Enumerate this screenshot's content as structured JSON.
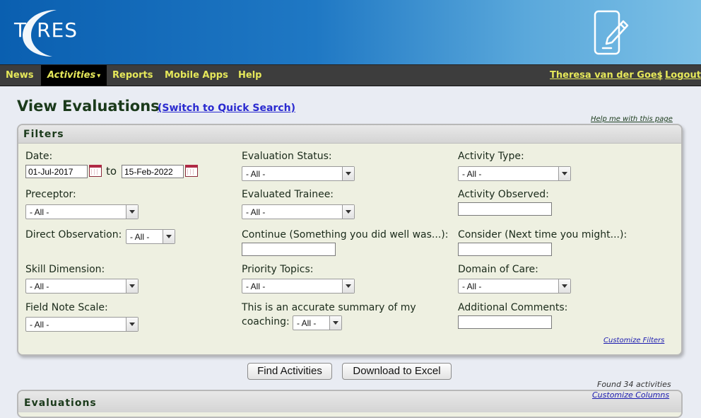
{
  "header": {
    "logo_text": "T RES",
    "logo_letters": [
      "T",
      "RES"
    ]
  },
  "nav": {
    "items": [
      {
        "label": "News"
      },
      {
        "label": "Activities",
        "active": true
      },
      {
        "label": "Reports"
      },
      {
        "label": "Mobile Apps"
      },
      {
        "label": "Help"
      }
    ],
    "caret": "▾",
    "user": "Theresa van der Goes",
    "separator": "|",
    "logout": "Logout",
    "text_color": "#e6e85a"
  },
  "page": {
    "title": "View Evaluations",
    "switch_link": "(Switch to Quick Search)",
    "help_link": "Help me with this page"
  },
  "filters": {
    "title": "Filters",
    "date_label": "Date:",
    "date_from": "01-Jul-2017",
    "date_to_word": "to",
    "date_to": "15-Feb-2022",
    "evaluation_status": {
      "label": "Evaluation Status:",
      "value": "- All -"
    },
    "activity_type": {
      "label": "Activity Type:",
      "value": "- All -"
    },
    "preceptor": {
      "label": "Preceptor:",
      "value": "- All -"
    },
    "evaluated_trainee": {
      "label": "Evaluated Trainee:",
      "value": "- All -"
    },
    "activity_observed": {
      "label": "Activity Observed:",
      "value": ""
    },
    "direct_observation": {
      "label": "Direct Observation:",
      "value": "- All -"
    },
    "continue": {
      "label": "Continue (Something you did well was...):",
      "value": ""
    },
    "consider": {
      "label": "Consider (Next time you might...):",
      "value": ""
    },
    "skill_dimension": {
      "label": "Skill Dimension:",
      "value": "- All -"
    },
    "priority_topics": {
      "label": "Priority Topics:",
      "value": "- All -"
    },
    "domain_of_care": {
      "label": "Domain of Care:",
      "value": "- All -"
    },
    "field_note_scale": {
      "label": "Field Note Scale:",
      "value": "- All -"
    },
    "accurate_summary": {
      "label_line1": "This is an accurate summary of my",
      "label_line2": "coaching:",
      "value": "- All -"
    },
    "additional_comments": {
      "label": "Additional Comments:",
      "value": ""
    },
    "customize_link": "Customize Filters"
  },
  "actions": {
    "find": "Find Activities",
    "download": "Download to Excel"
  },
  "results": {
    "found_text": "Found 34 activities",
    "customize_columns": "Customize Columns",
    "evaluations_title": "Evaluations"
  }
}
